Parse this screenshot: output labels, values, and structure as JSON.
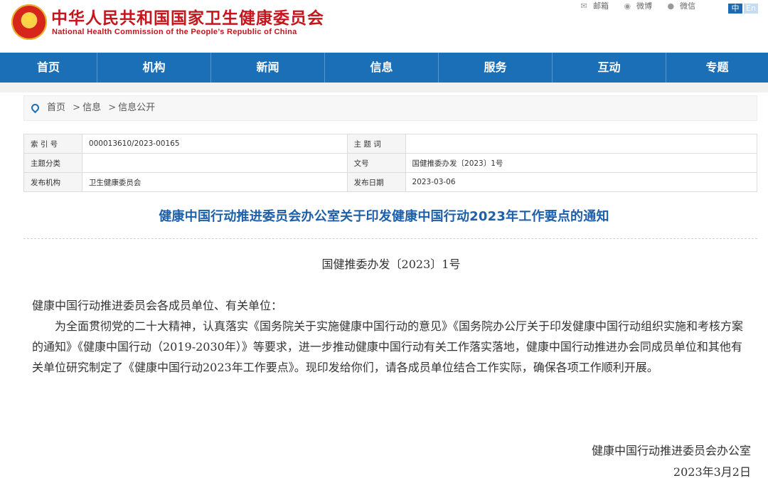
{
  "header": {
    "site_title_cn": "中华人民共和国国家卫生健康委员会",
    "site_title_en": "National Health Commission of the People’s Republic of China",
    "top_links": [
      {
        "label": "邮箱",
        "icon": "mail-icon"
      },
      {
        "label": "微博",
        "icon": "weibo-icon"
      },
      {
        "label": "微信",
        "icon": "wechat-icon"
      }
    ],
    "lang_zh": "中",
    "lang_en": "En"
  },
  "nav": {
    "items": [
      "首页",
      "机构",
      "新闻",
      "信息",
      "服务",
      "互动",
      "专题"
    ]
  },
  "breadcrumb": {
    "items": [
      "首页",
      "信息",
      "信息公开"
    ],
    "separator": ">"
  },
  "meta": {
    "index_label": "索 引 号",
    "index_value": "000013610/2023-00165",
    "keyword_label": "主 题 词",
    "keyword_value": "",
    "category_label": "主题分类",
    "category_value": "",
    "docno_label": "文号",
    "docno_value": "国健推委办发〔2023〕1号",
    "issuer_label": "发布机构",
    "issuer_value": "卫生健康委员会",
    "date_label": "发布日期",
    "date_value": "2023-03-06"
  },
  "article": {
    "title": "健康中国行动推进委员会办公室关于印发健康中国行动2023年工作要点的通知",
    "doc_number": "国健推委办发〔2023〕1号",
    "salutation": "健康中国行动推进委员会各成员单位、有关单位：",
    "paragraph": "为全面贯彻党的二十大精神，认真落实《国务院关于实施健康中国行动的意见》《国务院办公厅关于印发健康中国行动组织实施和考核方案的通知》《健康中国行动（2019-2030年）》等要求，进一步推动健康中国行动有关工作落实落地，健康中国行动推进办会同成员单位和其他有关单位研究制定了《健康中国行动2023年工作要点》。现印发给你们，请各成员单位结合工作实际，确保各项工作顺利开展。",
    "signature": "健康中国行动推进委员会办公室",
    "sign_date": "2023年3月2日"
  },
  "colors": {
    "brand_red": "#c5161d",
    "nav_blue": "#1a6fb6",
    "title_blue": "#1d5fa9"
  }
}
